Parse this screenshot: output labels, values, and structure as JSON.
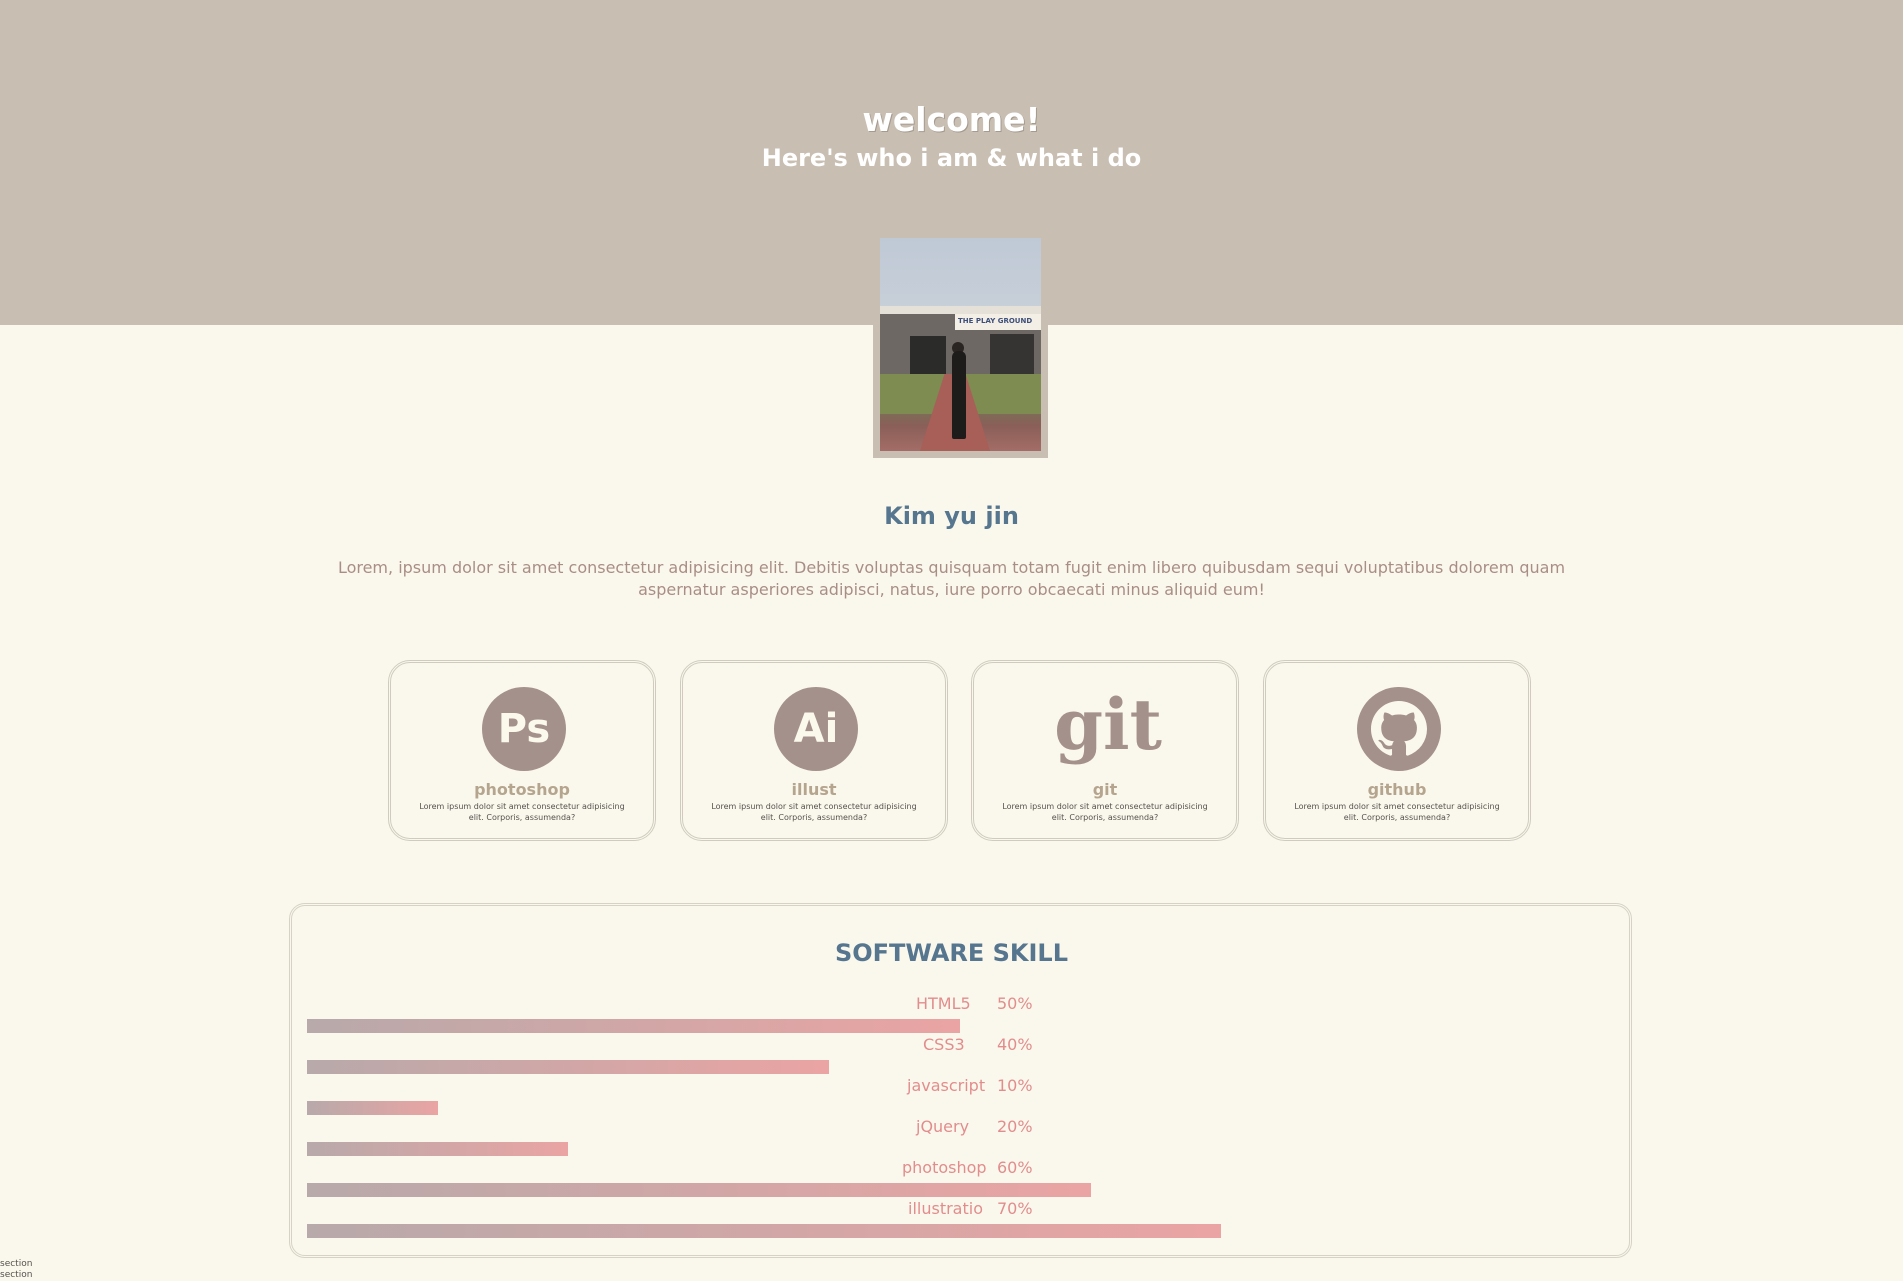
{
  "hero": {
    "title": "welcome!",
    "subtitle": "Here's who i am & what i do",
    "background_color": "#c8beb2",
    "photo_sign_text": "THE PLAY GROUND"
  },
  "profile": {
    "name": "Kim yu jin",
    "bio": "Lorem, ipsum dolor sit amet consectetur adipisicing elit. Debitis voluptas quisquam totam fugit enim libero quibusdam sequi voluptatibus dolorem quam aspernatur asperiores adipisci, natus, iure porro obcaecati minus aliquid eum!"
  },
  "cards": [
    {
      "icon": "photoshop-icon",
      "icon_text": "Ps",
      "title": "photoshop",
      "desc": "Lorem ipsum dolor sit amet consectetur adipisicing elit. Corporis, assumenda?"
    },
    {
      "icon": "illustrator-icon",
      "icon_text": "Ai",
      "title": "illust",
      "desc": "Lorem ipsum dolor sit amet consectetur adipisicing elit. Corporis, assumenda?"
    },
    {
      "icon": "git-icon",
      "icon_text": "git",
      "title": "git",
      "desc": "Lorem ipsum dolor sit amet consectetur adipisicing elit. Corporis, assumenda?"
    },
    {
      "icon": "github-icon",
      "icon_text": "",
      "title": "github",
      "desc": "Lorem ipsum dolor sit amet consectetur adipisicing elit. Corporis, assumenda?"
    }
  ],
  "skills": {
    "title": "SOFTWARE SKILL",
    "items": [
      {
        "name": "HTML5",
        "percent": "50%",
        "value": 50
      },
      {
        "name": "CSS3",
        "percent": "40%",
        "value": 40
      },
      {
        "name": "javascript",
        "percent": "10%",
        "value": 10
      },
      {
        "name": "jQuery",
        "percent": "20%",
        "value": 20
      },
      {
        "name": "photoshop",
        "percent": "60%",
        "value": 60
      },
      {
        "name": "illustratio",
        "percent": "70%",
        "value": 70
      }
    ],
    "bar_color_start": "#b8a9aa",
    "bar_color_end": "#eaa4a3",
    "label_color": "#e28d8d"
  },
  "footer": {
    "notes": [
      "section",
      "section"
    ]
  },
  "colors": {
    "page_background": "#faf8ec",
    "heading": "#56758f",
    "icon_fill": "#a4918b"
  }
}
